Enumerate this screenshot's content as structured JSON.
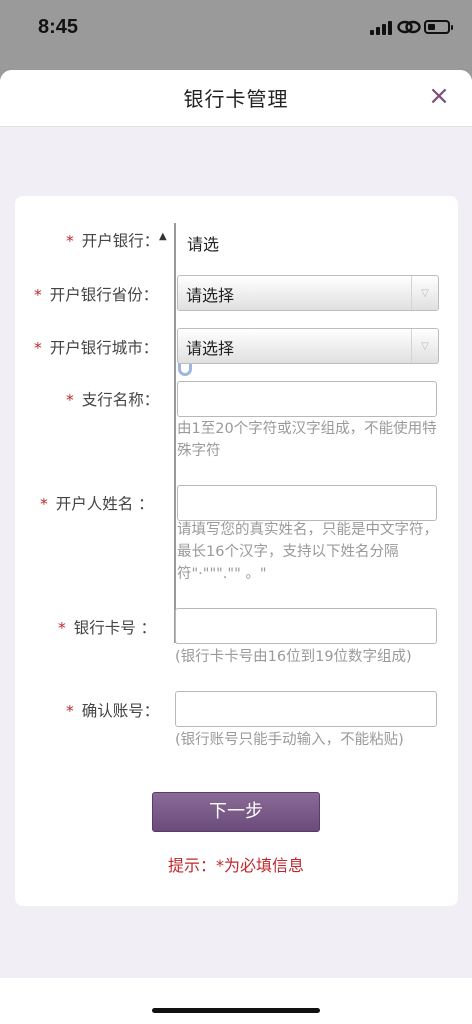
{
  "status_bar": {
    "time": "8:45"
  },
  "sheet": {
    "title": "银行卡管理",
    "close": "×"
  },
  "form": {
    "bank": {
      "required": "*",
      "label": "开户银行：",
      "value": "请选"
    },
    "province": {
      "required": "*",
      "label": "开户银行省份：",
      "value": "请选择"
    },
    "city": {
      "required": "*",
      "label": "开户银行城市：",
      "value": "请选择"
    },
    "branch": {
      "required": "*",
      "label": "支行名称：",
      "value": "",
      "hint": "由1至20个字符或汉字组成，不能使用特殊字符"
    },
    "holder": {
      "required": "*",
      "label": "开户人姓名 ：",
      "value": "",
      "hint": "请填写您的真实姓名，只能是中文字符，最长16个汉字，支持以下姓名分隔符\"·\"\"\".\"\" 。\""
    },
    "card_no": {
      "required": "*",
      "label": "银行卡号 ：",
      "value": "",
      "hint": "(银行卡卡号由16位到19位数字组成)"
    },
    "confirm_no": {
      "required": "*",
      "label": "确认账号：",
      "value": "",
      "hint": "(银行账号只能手动输入，不能粘贴)"
    }
  },
  "next_button": "下一步",
  "tip": "提示：*为必填信息"
}
